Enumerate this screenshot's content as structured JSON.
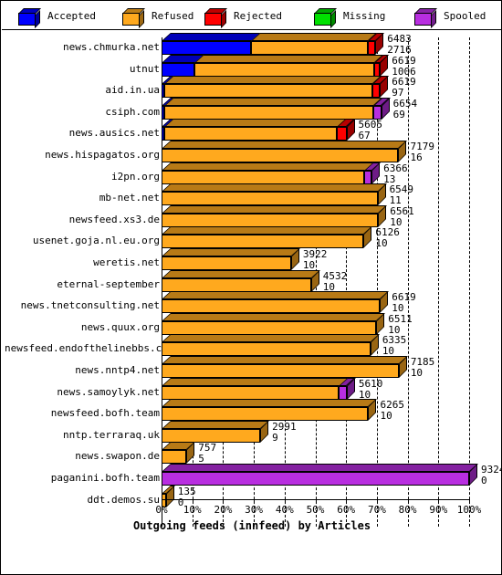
{
  "legend": {
    "items": [
      {
        "label": "Accepted",
        "color": "#0000ff",
        "icon": "cube-icon"
      },
      {
        "label": "Refused",
        "color": "#ffa91e",
        "icon": "cube-icon"
      },
      {
        "label": "Rejected",
        "color": "#ff0000",
        "icon": "cube-icon"
      },
      {
        "label": "Missing",
        "color": "#00e000",
        "icon": "cube-icon"
      },
      {
        "label": "Spooled",
        "color": "#b82ee0",
        "icon": "cube-icon"
      }
    ]
  },
  "chart_data": {
    "type": "bar",
    "orientation": "horizontal",
    "stacked": true,
    "title": "Outgoing feeds (innfeed) by Articles",
    "xlabel": "",
    "ylabel": "",
    "xlim": [
      0,
      100
    ],
    "xticks": [
      "0%",
      "10%",
      "20%",
      "30%",
      "40%",
      "50%",
      "60%",
      "70%",
      "80%",
      "90%",
      "100%"
    ],
    "grid": true,
    "legend_position": "top",
    "series_names": [
      "Accepted",
      "Refused",
      "Rejected",
      "Missing",
      "Spooled"
    ],
    "categories": [
      "news.chmurka.net",
      "utnut",
      "aid.in.ua",
      "csiph.com",
      "news.ausics.net",
      "news.hispagatos.org",
      "i2pn.org",
      "mb-net.net",
      "newsfeed.xs3.de",
      "usenet.goja.nl.eu.org",
      "weretis.net",
      "eternal-september",
      "news.tnetconsulting.net",
      "news.quux.org",
      "newsfeed.endofthelinebbs.com",
      "news.nntp4.net",
      "news.samoylyk.net",
      "newsfeed.bofh.team",
      "nntp.terraraq.uk",
      "news.swapon.de",
      "paganini.bofh.team",
      "ddt.demos.su"
    ],
    "rows": [
      {
        "name": "news.chmurka.net",
        "total": 6483,
        "second": 2716,
        "pct": 69.5,
        "segments": [
          {
            "type": "Accepted",
            "pct": 29.1
          },
          {
            "type": "Refused",
            "pct": 38.0
          },
          {
            "type": "Rejected",
            "pct": 2.4
          }
        ]
      },
      {
        "name": "utnut",
        "total": 6619,
        "second": 1006,
        "pct": 71.0,
        "segments": [
          {
            "type": "Accepted",
            "pct": 10.8
          },
          {
            "type": "Refused",
            "pct": 58.4
          },
          {
            "type": "Rejected",
            "pct": 1.8
          }
        ]
      },
      {
        "name": "aid.in.ua",
        "total": 6619,
        "second": 97,
        "pct": 71.0,
        "segments": [
          {
            "type": "Accepted",
            "pct": 1.0
          },
          {
            "type": "Refused",
            "pct": 67.6
          },
          {
            "type": "Rejected",
            "pct": 2.4
          }
        ]
      },
      {
        "name": "csiph.com",
        "total": 6654,
        "second": 69,
        "pct": 71.4,
        "segments": [
          {
            "type": "Accepted",
            "pct": 0.8
          },
          {
            "type": "Refused",
            "pct": 68.1
          },
          {
            "type": "Spooled",
            "pct": 2.5
          }
        ]
      },
      {
        "name": "news.ausics.net",
        "total": 5605,
        "second": 67,
        "pct": 60.1,
        "segments": [
          {
            "type": "Accepted",
            "pct": 0.8
          },
          {
            "type": "Refused",
            "pct": 56.3
          },
          {
            "type": "Rejected",
            "pct": 3.0
          }
        ]
      },
      {
        "name": "news.hispagatos.org",
        "total": 7179,
        "second": 16,
        "pct": 77.0,
        "segments": [
          {
            "type": "Refused",
            "pct": 77.0
          }
        ]
      },
      {
        "name": "i2pn.org",
        "total": 6366,
        "second": 13,
        "pct": 68.3,
        "segments": [
          {
            "type": "Refused",
            "pct": 65.8
          },
          {
            "type": "Spooled",
            "pct": 2.5
          }
        ]
      },
      {
        "name": "mb-net.net",
        "total": 6549,
        "second": 11,
        "pct": 70.2,
        "segments": [
          {
            "type": "Refused",
            "pct": 70.2
          }
        ]
      },
      {
        "name": "newsfeed.xs3.de",
        "total": 6561,
        "second": 10,
        "pct": 70.4,
        "segments": [
          {
            "type": "Refused",
            "pct": 70.4
          }
        ]
      },
      {
        "name": "usenet.goja.nl.eu.org",
        "total": 6126,
        "second": 10,
        "pct": 65.7,
        "segments": [
          {
            "type": "Refused",
            "pct": 65.7
          }
        ]
      },
      {
        "name": "weretis.net",
        "total": 3922,
        "second": 10,
        "pct": 42.1,
        "segments": [
          {
            "type": "Refused",
            "pct": 42.1
          }
        ]
      },
      {
        "name": "eternal-september",
        "total": 4532,
        "second": 10,
        "pct": 48.6,
        "segments": [
          {
            "type": "Refused",
            "pct": 48.6
          }
        ]
      },
      {
        "name": "news.tnetconsulting.net",
        "total": 6619,
        "second": 10,
        "pct": 71.0,
        "segments": [
          {
            "type": "Refused",
            "pct": 71.0
          }
        ]
      },
      {
        "name": "news.quux.org",
        "total": 6511,
        "second": 10,
        "pct": 69.8,
        "segments": [
          {
            "type": "Refused",
            "pct": 69.8
          }
        ]
      },
      {
        "name": "newsfeed.endofthelinebbs.com",
        "total": 6335,
        "second": 10,
        "pct": 67.9,
        "segments": [
          {
            "type": "Refused",
            "pct": 67.9
          }
        ]
      },
      {
        "name": "news.nntp4.net",
        "total": 7185,
        "second": 10,
        "pct": 77.1,
        "segments": [
          {
            "type": "Refused",
            "pct": 77.1
          }
        ]
      },
      {
        "name": "news.samoylyk.net",
        "total": 5610,
        "second": 10,
        "pct": 60.2,
        "segments": [
          {
            "type": "Refused",
            "pct": 57.7
          },
          {
            "type": "Spooled",
            "pct": 2.5
          }
        ]
      },
      {
        "name": "newsfeed.bofh.team",
        "total": 6265,
        "second": 10,
        "pct": 67.2,
        "segments": [
          {
            "type": "Refused",
            "pct": 67.2
          }
        ]
      },
      {
        "name": "nntp.terraraq.uk",
        "total": 2991,
        "second": 9,
        "pct": 32.1,
        "segments": [
          {
            "type": "Refused",
            "pct": 32.1
          }
        ]
      },
      {
        "name": "news.swapon.de",
        "total": 757,
        "second": 5,
        "pct": 8.1,
        "segments": [
          {
            "type": "Refused",
            "pct": 8.1
          }
        ]
      },
      {
        "name": "paganini.bofh.team",
        "total": 9324,
        "second": 0,
        "pct": 100.0,
        "segments": [
          {
            "type": "Spooled",
            "pct": 100.0
          }
        ]
      },
      {
        "name": "ddt.demos.su",
        "total": 135,
        "second": 0,
        "pct": 1.4,
        "segments": [
          {
            "type": "Refused",
            "pct": 1.4
          }
        ]
      }
    ]
  }
}
